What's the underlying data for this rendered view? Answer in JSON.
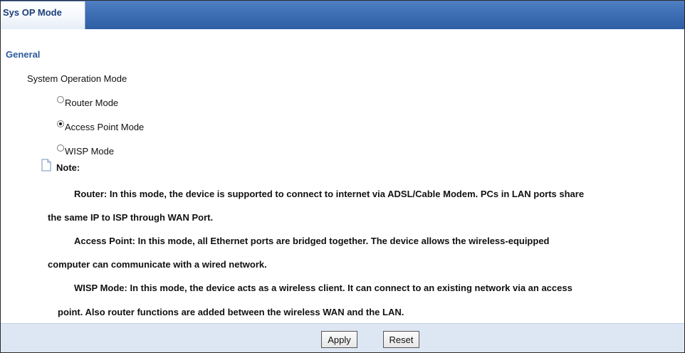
{
  "tabs": [
    {
      "label": "Sys OP Mode",
      "active": true
    }
  ],
  "section": {
    "title": "General"
  },
  "system_operation_mode": {
    "label": "System Operation Mode",
    "options": [
      {
        "label": "Router Mode",
        "checked": false
      },
      {
        "label": "Access Point Mode",
        "checked": true
      },
      {
        "label": "WISP Mode",
        "checked": false
      }
    ]
  },
  "note": {
    "label": "Note:",
    "lines": [
      "Router: In this mode, the device is supported to connect to internet via ADSL/Cable Modem. PCs in LAN ports share",
      "the same IP to ISP through WAN Port.",
      "Access Point: In this mode, all Ethernet ports are bridged together. The device allows the wireless-equipped",
      "computer can communicate with a wired network.",
      "WISP Mode: In this mode, the device acts as a wireless client. It can connect to an existing network via an access",
      "point. Also router functions are added between the wireless WAN and the LAN."
    ]
  },
  "buttons": {
    "apply": "Apply",
    "reset": "Reset"
  },
  "colors": {
    "tab_bar": "#3b6bb1",
    "section_title": "#2c5a9e",
    "footer_bg": "#dde6f3"
  },
  "icons": {
    "note": "note-icon"
  }
}
